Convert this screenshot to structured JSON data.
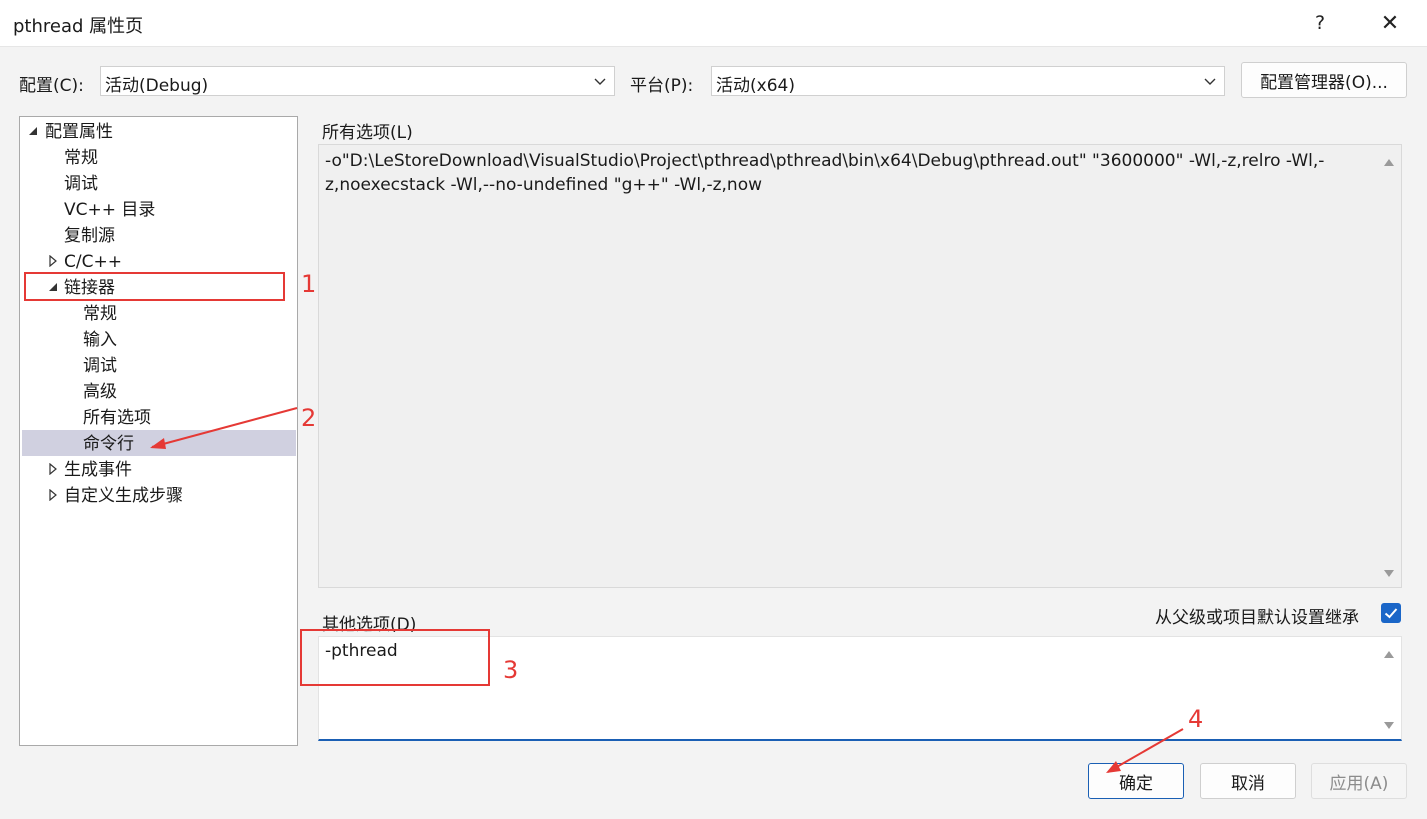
{
  "window": {
    "title": "pthread 属性页",
    "help_label": "?",
    "close_label": "✕"
  },
  "config_bar": {
    "config_label": "配置(C):",
    "config_value": "活动(Debug)",
    "platform_label": "平台(P):",
    "platform_value": "活动(x64)",
    "manager_button": "配置管理器(O)..."
  },
  "tree": {
    "root": "配置属性",
    "items": {
      "general": "常规",
      "debugging": "调试",
      "vc_dirs": "VC++ 目录",
      "copy_source": "复制源",
      "cpp": "C/C++",
      "linker": "链接器",
      "linker_general": "常规",
      "linker_input": "输入",
      "linker_debugging": "调试",
      "linker_advanced": "高级",
      "linker_all_options": "所有选项",
      "linker_cmdline": "命令行",
      "build_events": "生成事件",
      "custom_build": "自定义生成步骤"
    },
    "selected": "命令行"
  },
  "main": {
    "all_options_label": "所有选项(L)",
    "all_options_text": "-o\"D:\\LeStoreDownload\\VisualStudio\\Project\\pthread\\pthread\\bin\\x64\\Debug\\pthread.out\" \"3600000\" -Wl,-z,relro -Wl,-z,noexecstack -Wl,--no-undefined \"g++\" -Wl,-z,now",
    "other_options_label": "其他选项(D)",
    "inherit_label": "从父级或项目默认设置继承",
    "inherit_checked": true,
    "other_options_value": "-pthread"
  },
  "buttons": {
    "ok": "确定",
    "cancel": "取消",
    "apply": "应用(A)"
  },
  "annotations": {
    "n1": "1",
    "n2": "2",
    "n3": "3",
    "n4": "4"
  },
  "colors": {
    "annotation": "#e53935",
    "selection": "#d0d0e0",
    "accent": "#1a66c8"
  }
}
